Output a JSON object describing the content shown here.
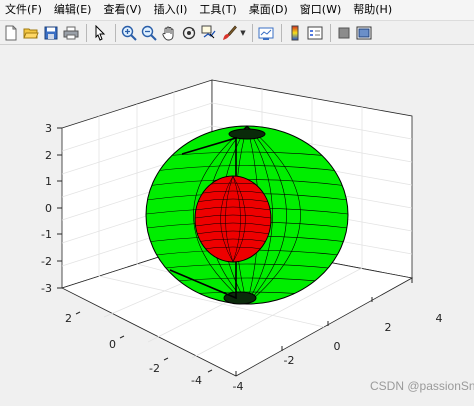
{
  "menu": {
    "items": [
      {
        "label": "文件(F)"
      },
      {
        "label": "编辑(E)"
      },
      {
        "label": "查看(V)"
      },
      {
        "label": "插入(I)"
      },
      {
        "label": "工具(T)"
      },
      {
        "label": "桌面(D)"
      },
      {
        "label": "窗口(W)"
      },
      {
        "label": "帮助(H)"
      }
    ]
  },
  "toolbar": {
    "icons": [
      "new-figure-icon",
      "open-file-icon",
      "save-icon",
      "print-icon",
      "select-pointer-icon",
      "zoom-in-icon",
      "zoom-out-icon",
      "pan-hand-icon",
      "rotate-3d-icon",
      "data-cursor-icon",
      "brush-icon",
      "link-plot-icon",
      "insert-colorbar-icon",
      "insert-legend-icon",
      "hide-plot-tools-icon",
      "show-plot-tools-icon"
    ]
  },
  "chart_data": {
    "type": "surface-3d",
    "title": "",
    "xlabel": "",
    "ylabel": "",
    "zlabel": "",
    "x_ticks": [
      "-4",
      "-2",
      "0",
      "2",
      "4"
    ],
    "y_ticks": [
      "-4",
      "-2",
      "0",
      "2"
    ],
    "z_ticks": [
      "-3",
      "-2",
      "-1",
      "0",
      "1",
      "2",
      "3"
    ],
    "xlim": [
      -4,
      4
    ],
    "ylim": [
      -4,
      4
    ],
    "zlim": [
      -3,
      3
    ],
    "grid": true,
    "series": [
      {
        "shape": "sphere with cut-away wedge",
        "radius": 3,
        "color": "#00ff00"
      },
      {
        "shape": "inner sphere",
        "radius": 1.5,
        "color": "#ff0000"
      }
    ]
  },
  "watermark": "CSDN @passionSnail"
}
